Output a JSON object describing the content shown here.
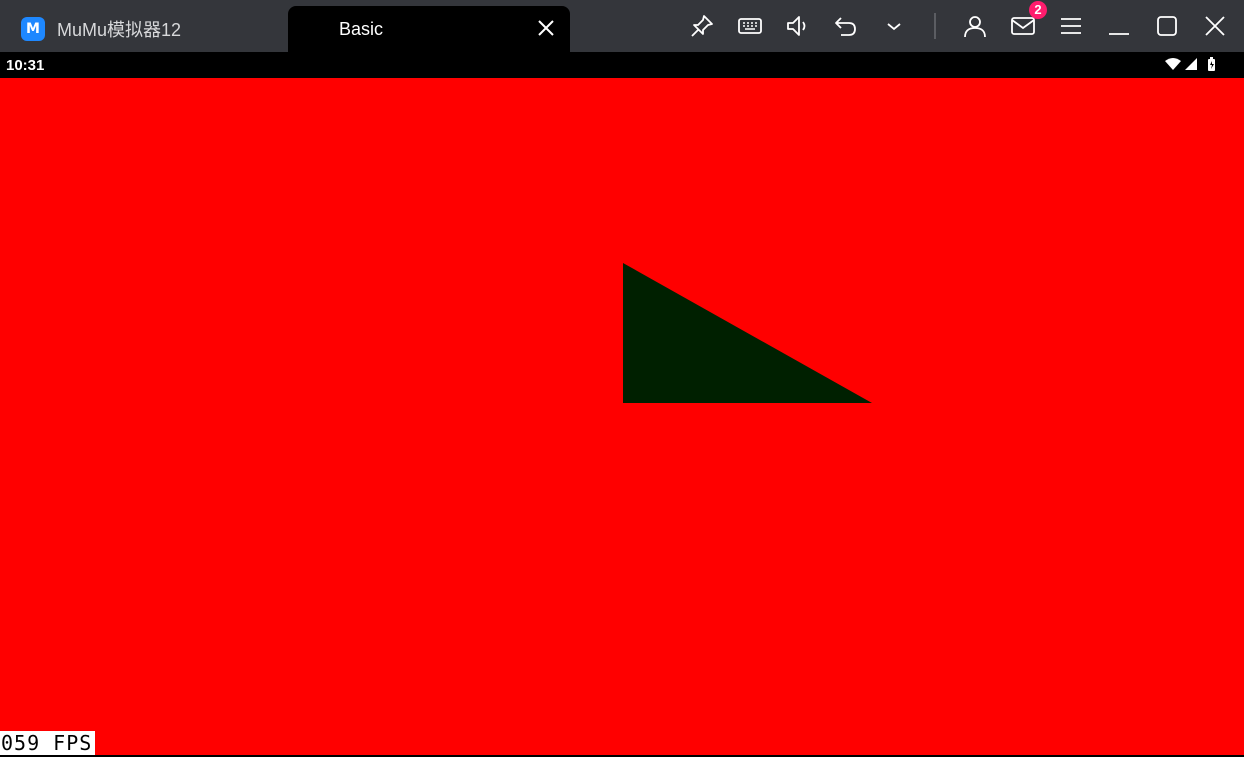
{
  "window": {
    "home_tab_label": "MuMu模拟器12",
    "active_tab_label": "Basic",
    "app_logo_text": "M"
  },
  "toolbar": {
    "icons": [
      "pin-icon",
      "keyboard-icon",
      "volume-icon",
      "back-icon",
      "chevron-down-icon",
      "account-icon",
      "mail-icon",
      "menu-icon",
      "minimize-icon",
      "maximize-icon",
      "close-icon"
    ],
    "mail_badge_count": "2"
  },
  "status_bar": {
    "time": "10:31",
    "icons": [
      "wifi-icon",
      "signal-icon",
      "battery-icon"
    ]
  },
  "scene": {
    "background_color": "#ff0000",
    "shape_color": "#002000",
    "fps_text": "059 FPS"
  }
}
